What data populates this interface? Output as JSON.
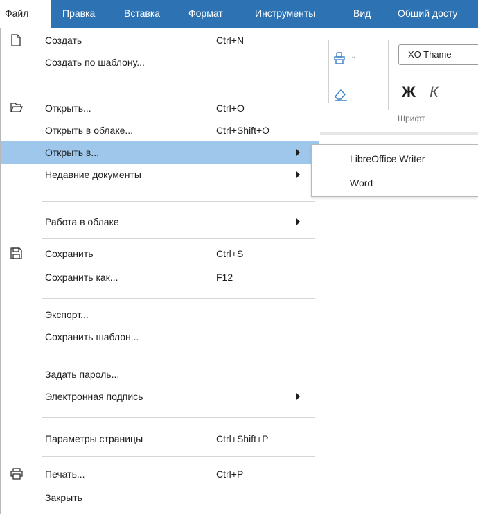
{
  "menubar": {
    "items": [
      {
        "label": "Файл"
      },
      {
        "label": "Правка"
      },
      {
        "label": "Вставка"
      },
      {
        "label": "Формат"
      },
      {
        "label": "Инструменты"
      },
      {
        "label": "Вид"
      },
      {
        "label": "Общий досту"
      }
    ]
  },
  "toolbar": {
    "font_name": "XO Thame",
    "bold_glyph": "Ж",
    "italic_glyph": "К",
    "group_label": "Шрифт"
  },
  "file_menu": {
    "items": [
      {
        "label": "Создать",
        "shortcut": "Ctrl+N"
      },
      {
        "label": "Создать по шаблону...",
        "shortcut": ""
      },
      {
        "label": "Открыть...",
        "shortcut": "Ctrl+O"
      },
      {
        "label": "Открыть в облаке...",
        "shortcut": "Ctrl+Shift+O"
      },
      {
        "label": "Открыть в...",
        "shortcut": ""
      },
      {
        "label": "Недавние документы",
        "shortcut": ""
      },
      {
        "label": "Работа в облаке",
        "shortcut": ""
      },
      {
        "label": "Сохранить",
        "shortcut": "Ctrl+S"
      },
      {
        "label": "Сохранить как...",
        "shortcut": "F12"
      },
      {
        "label": "Экспорт...",
        "shortcut": ""
      },
      {
        "label": "Сохранить шаблон...",
        "shortcut": ""
      },
      {
        "label": "Задать пароль...",
        "shortcut": ""
      },
      {
        "label": "Электронная подпись",
        "shortcut": ""
      },
      {
        "label": "Параметры страницы",
        "shortcut": "Ctrl+Shift+P"
      },
      {
        "label": "Печать...",
        "shortcut": "Ctrl+P"
      },
      {
        "label": "Закрыть",
        "shortcut": ""
      }
    ]
  },
  "open_in_submenu": {
    "items": [
      {
        "label": "LibreOffice Writer"
      },
      {
        "label": "Word"
      }
    ]
  },
  "colors": {
    "menubar": "#2d73b4",
    "highlight": "#9fc7ec"
  }
}
